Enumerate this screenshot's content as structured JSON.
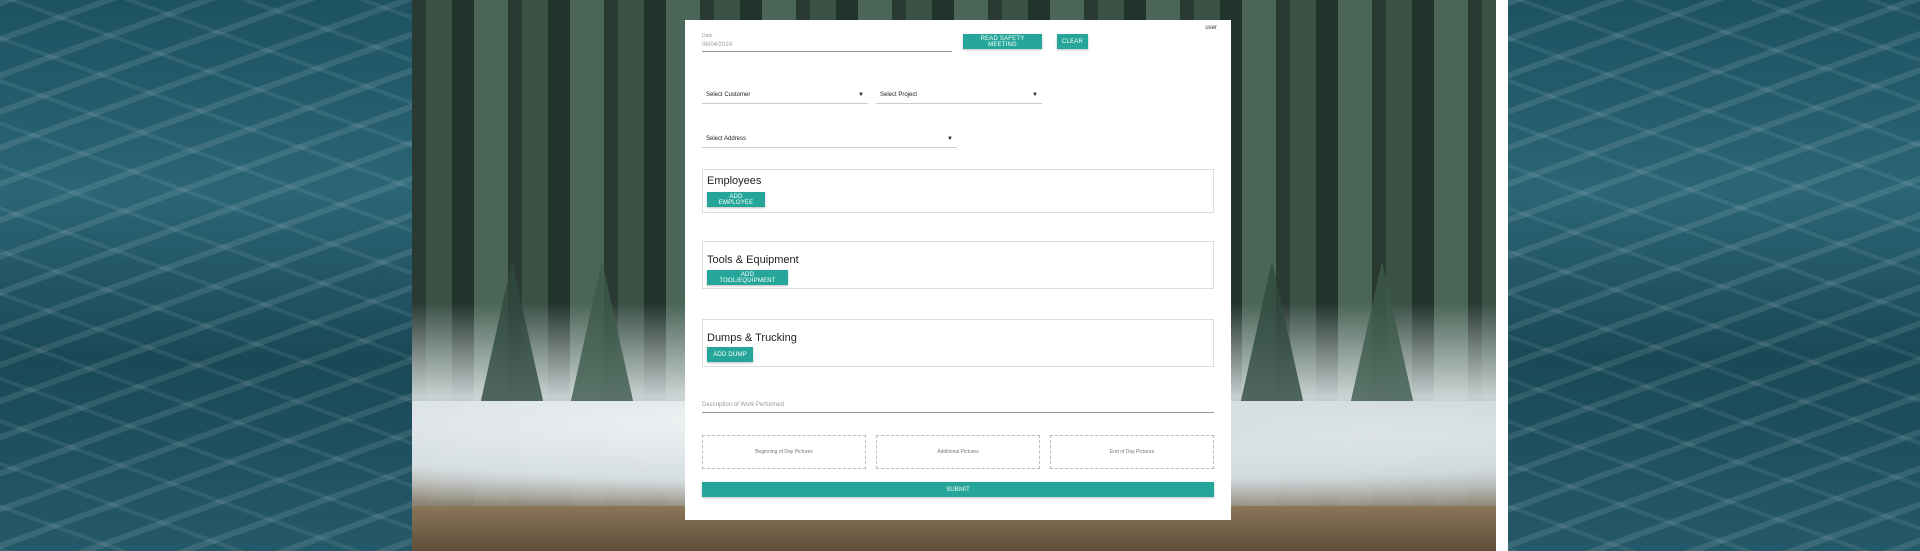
{
  "header": {
    "user_label": "user"
  },
  "date": {
    "label": "Date",
    "value": "06/04/2024"
  },
  "actions": {
    "safety_label": "READ SAFETY MEETING",
    "clear_label": "CLEAR"
  },
  "selects": {
    "customer": "Select Customer",
    "project": "Select Project",
    "address": "Select Address"
  },
  "sections": {
    "employees": {
      "title": "Employees",
      "button": "ADD EMPLOYEE"
    },
    "tools": {
      "title": "Tools & Equipment",
      "button": "ADD TOOL/EQUIPMENT"
    },
    "dumps": {
      "title": "Dumps & Trucking",
      "button": "ADD DUMP"
    }
  },
  "description": {
    "placeholder": "Description of Work Performed"
  },
  "pictures": {
    "beginning": "Beginning of Day Pictures",
    "additional": "Additional Pictures",
    "end": "End of Day Pictures"
  },
  "submit_label": "SUBMIT",
  "colors": {
    "accent": "#26a69a",
    "card": "#ffffff"
  },
  "icons": {
    "dropdown": "chevron-down-icon"
  }
}
